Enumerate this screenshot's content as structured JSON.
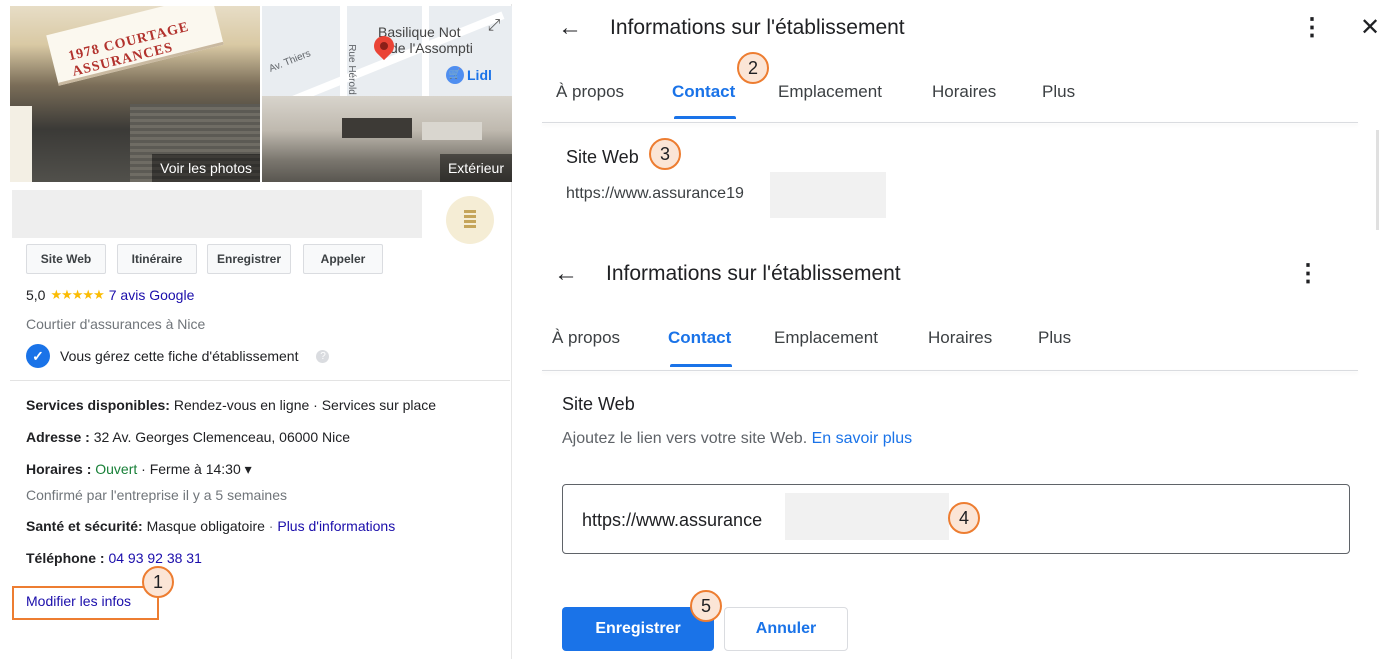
{
  "left_panel": {
    "photo_main": {
      "sign_text": "1978 COURTAGE ASSURANCES",
      "caption": "Voir les photos"
    },
    "photo_sub": {
      "map_title_line1": "Basilique Not",
      "map_title_line2": "de l'Assompti",
      "street_label_1": "Av. Thiers",
      "street_label_2": "Rue Hérold",
      "store_label": "Lidl",
      "caption": "Extérieur"
    },
    "actions": [
      "Site Web",
      "Itinéraire",
      "Enregistrer",
      "Appeler"
    ],
    "rating": {
      "value": "5,0",
      "stars": "★★★★★",
      "reviews_link": "7 avis Google"
    },
    "category": "Courtier d'assurances à Nice",
    "verified_text": "Vous gérez cette fiche d'établissement",
    "services": {
      "label": "Services disponibles:",
      "value": "Rendez-vous en ligne · Services sur place"
    },
    "address": {
      "label": "Adresse :",
      "value": "32 Av. Georges Clemenceau, 06000 Nice"
    },
    "hours": {
      "label": "Horaires :",
      "status": "Ouvert",
      "closing": "· Ferme à 14:30",
      "caret": "▾"
    },
    "hours_confirmed": "Confirmé par l'entreprise il y a 5 semaines",
    "safety": {
      "label": "Santé et sécurité:",
      "value": "Masque obligatoire",
      "separator": "·",
      "link": "Plus d'informations"
    },
    "phone": {
      "label": "Téléphone :",
      "value": "04 93 92 38 31"
    },
    "edit_link": "Modifier les infos"
  },
  "callouts": [
    "1",
    "2",
    "3",
    "4",
    "5"
  ],
  "panel_top": {
    "title": "Informations sur l'établissement",
    "back_icon": "←",
    "more_icon": "⋮",
    "close_icon": "✕",
    "tabs": [
      "À propos",
      "Contact",
      "Emplacement",
      "Horaires",
      "Plus"
    ],
    "active_tab": "Contact",
    "section_label": "Site Web",
    "url_value": "https://www.assurance19"
  },
  "panel_bottom": {
    "title": "Informations sur l'établissement",
    "back_icon": "←",
    "more_icon": "⋮",
    "tabs": [
      "À propos",
      "Contact",
      "Emplacement",
      "Horaires",
      "Plus"
    ],
    "active_tab": "Contact",
    "section_label": "Site Web",
    "helper_text": "Ajoutez le lien vers votre site Web.",
    "helper_link": "En savoir plus",
    "input_value": "https://www.assurance",
    "save_label": "Enregistrer",
    "cancel_label": "Annuler"
  },
  "colors": {
    "accent": "#1a73e8",
    "link": "#1a0dab",
    "open_status": "#188038",
    "callout_border": "#ed7d31",
    "callout_fill": "#fbe5d6",
    "star": "#fbbc04"
  }
}
